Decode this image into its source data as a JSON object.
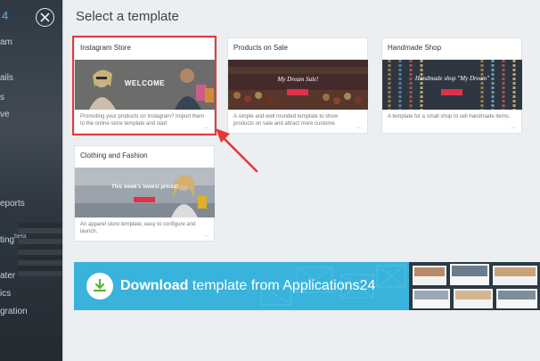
{
  "sidebar": {
    "labels": [
      "4",
      "am",
      "ails",
      "s",
      "ve",
      "eports",
      "ting",
      "beta",
      "ater",
      "ics",
      "gration"
    ]
  },
  "dialog": {
    "title": "Select a template"
  },
  "templates": [
    {
      "title": "Instagram Store",
      "thumb_text": "WELCOME",
      "description": "Promoting your products on Instagram? Import them to the online store template and start",
      "more": "..."
    },
    {
      "title": "Products on Sale",
      "thumb_text": "My Dream Sale!",
      "description": "A simple and well rounded template to show products on sale and attract more custome",
      "more": "..."
    },
    {
      "title": "Handmade Shop",
      "thumb_text": "Handmade shop \"My Dream\"",
      "description": "A template for a small shop to sell handmade items.",
      "more": "..."
    },
    {
      "title": "Clothing and Fashion",
      "thumb_text": "This week's lowest prices!",
      "description": "An apparel store template, easy to configure and launch.",
      "more": "..."
    }
  ],
  "banner": {
    "bold": "Download",
    "rest": " template from Applications24"
  },
  "colors": {
    "accent": "#39b3dc",
    "selection": "#e23b3b",
    "sale_button": "#e0304a"
  }
}
